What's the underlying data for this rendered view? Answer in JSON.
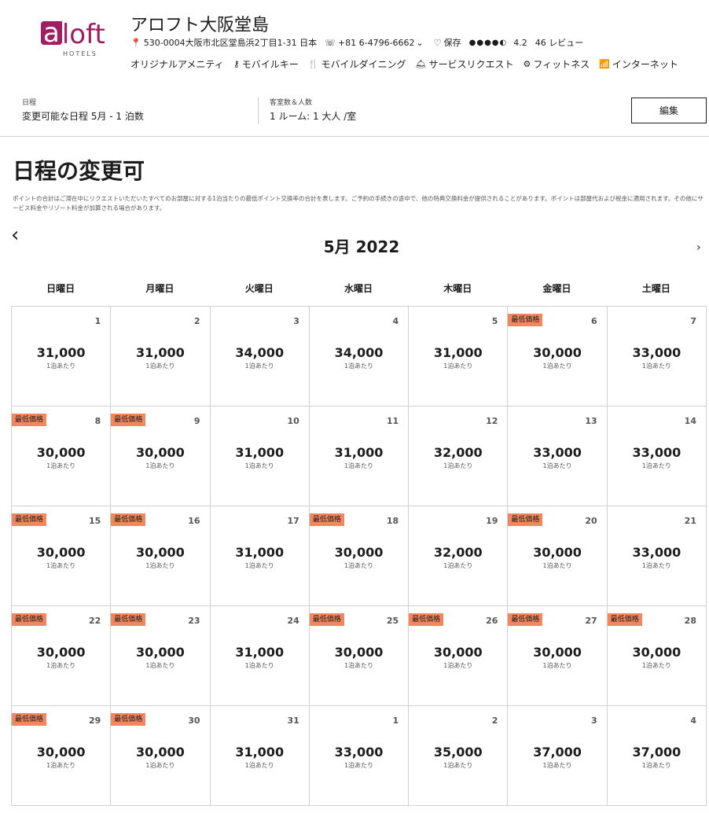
{
  "hotel": {
    "logo_text": "aloft",
    "logo_sub": "HOTELS",
    "name": "アロフト大阪堂島",
    "address": "530-0004大阪市北区堂島浜2丁目1-31 日本",
    "phone": "+81 6-4796-6662",
    "save_label": "保存",
    "rating_stars": "●●●●◐",
    "rating": "4.2",
    "reviews": "46 レビュー",
    "amenities": [
      {
        "icon": "",
        "label": "オリジナルアメニティ"
      },
      {
        "icon": "⚷",
        "label": "モバイルキー"
      },
      {
        "icon": "🍴",
        "label": "モバイルダイニング"
      },
      {
        "icon": "🛎",
        "label": "サービスリクエスト"
      },
      {
        "icon": "⚙",
        "label": "フィットネス"
      },
      {
        "icon": "📶",
        "label": "インターネット"
      }
    ]
  },
  "search": {
    "dates_label": "日程",
    "dates_value": "変更可能な日程 5月 - 1 泊数",
    "rooms_label": "客室数＆人数",
    "rooms_value": "1 ルーム: 1 大人 /室",
    "edit_label": "編集"
  },
  "page": {
    "title": "日程の変更可",
    "disclaimer": "ポイントの合計はご滞在中にリクエストいただいたすべてのお部屋に対する1泊当たりの最低ポイント交換率の合計を表します。ご予約の手続きの途中で、他の特典交換料金が提供されることがあります。ポイントは部屋代および税金に適用されます。その他にサービス料金やリゾート料金が加算される場合があります。"
  },
  "calendar": {
    "month_title": "5月 2022",
    "prev_icon": "‹",
    "next_icon": "›",
    "weekdays": [
      "日曜日",
      "月曜日",
      "火曜日",
      "水曜日",
      "木曜日",
      "金曜日",
      "土曜日"
    ],
    "badge_label": "最低価格",
    "per_night_label": "1泊あたり",
    "days": [
      {
        "day": "1",
        "price": "31,000",
        "lowest": false
      },
      {
        "day": "2",
        "price": "31,000",
        "lowest": false
      },
      {
        "day": "3",
        "price": "34,000",
        "lowest": false
      },
      {
        "day": "4",
        "price": "34,000",
        "lowest": false
      },
      {
        "day": "5",
        "price": "31,000",
        "lowest": false
      },
      {
        "day": "6",
        "price": "30,000",
        "lowest": true
      },
      {
        "day": "7",
        "price": "33,000",
        "lowest": false
      },
      {
        "day": "8",
        "price": "30,000",
        "lowest": true
      },
      {
        "day": "9",
        "price": "30,000",
        "lowest": true
      },
      {
        "day": "10",
        "price": "31,000",
        "lowest": false
      },
      {
        "day": "11",
        "price": "31,000",
        "lowest": false
      },
      {
        "day": "12",
        "price": "32,000",
        "lowest": false
      },
      {
        "day": "13",
        "price": "33,000",
        "lowest": false
      },
      {
        "day": "14",
        "price": "33,000",
        "lowest": false
      },
      {
        "day": "15",
        "price": "30,000",
        "lowest": true
      },
      {
        "day": "16",
        "price": "30,000",
        "lowest": true
      },
      {
        "day": "17",
        "price": "31,000",
        "lowest": false
      },
      {
        "day": "18",
        "price": "30,000",
        "lowest": true
      },
      {
        "day": "19",
        "price": "32,000",
        "lowest": false
      },
      {
        "day": "20",
        "price": "30,000",
        "lowest": true
      },
      {
        "day": "21",
        "price": "33,000",
        "lowest": false
      },
      {
        "day": "22",
        "price": "30,000",
        "lowest": true
      },
      {
        "day": "23",
        "price": "30,000",
        "lowest": true
      },
      {
        "day": "24",
        "price": "31,000",
        "lowest": false
      },
      {
        "day": "25",
        "price": "30,000",
        "lowest": true
      },
      {
        "day": "26",
        "price": "30,000",
        "lowest": true
      },
      {
        "day": "27",
        "price": "30,000",
        "lowest": true
      },
      {
        "day": "28",
        "price": "30,000",
        "lowest": true
      },
      {
        "day": "29",
        "price": "30,000",
        "lowest": true
      },
      {
        "day": "30",
        "price": "30,000",
        "lowest": true
      },
      {
        "day": "31",
        "price": "31,000",
        "lowest": false
      },
      {
        "day": "1",
        "price": "33,000",
        "lowest": false
      },
      {
        "day": "2",
        "price": "35,000",
        "lowest": false
      },
      {
        "day": "3",
        "price": "37,000",
        "lowest": false
      },
      {
        "day": "4",
        "price": "37,000",
        "lowest": false
      }
    ]
  },
  "colors": {
    "brand": "#9e2062",
    "badge": "#f2875f",
    "border": "#d0d0d0"
  }
}
